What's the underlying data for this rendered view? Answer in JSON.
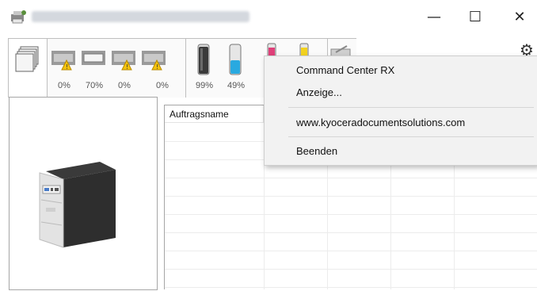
{
  "window": {
    "minimize_glyph": "—",
    "maximize_glyph": "☐",
    "close_glyph": "✕",
    "settings_glyph": "⚙"
  },
  "toolbar": {
    "status_levels": [
      {
        "name": "paper-tray-1",
        "value": "0%",
        "warning": true
      },
      {
        "name": "paper-tray-2",
        "value": "70%",
        "warning": false
      },
      {
        "name": "paper-tray-3",
        "value": "0%",
        "warning": true
      },
      {
        "name": "paper-tray-4",
        "value": "0%",
        "warning": true
      },
      {
        "name": "toner-black",
        "value": "99%",
        "warning": false
      },
      {
        "name": "toner-cyan",
        "value": "49%",
        "warning": false
      }
    ]
  },
  "jobs_table": {
    "columns": [
      "Auftragsname"
    ]
  },
  "context_menu": {
    "items": [
      "Command Center RX",
      "Anzeige...",
      "www.kyoceradocumentsolutions.com",
      "Beenden"
    ]
  },
  "colors": {
    "warning": "#f4c20d",
    "toner_black": "#3a3a3a",
    "toner_cyan": "#29a9e0",
    "toner_magenta": "#e0407a",
    "toner_yellow": "#f2d21f"
  }
}
